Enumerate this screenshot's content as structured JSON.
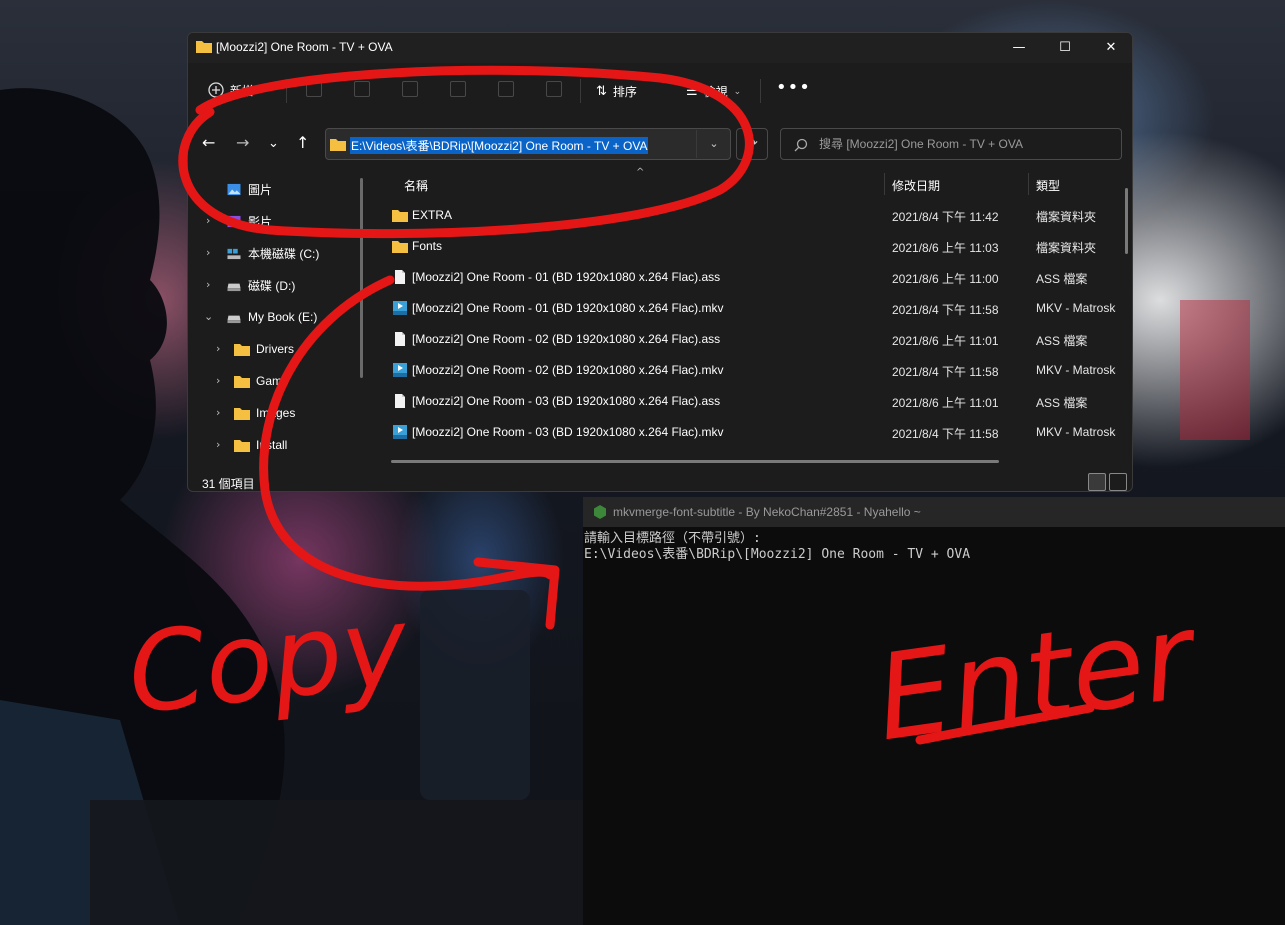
{
  "explorer": {
    "title": "[Moozzi2] One Room - TV + OVA",
    "window_buttons": {
      "minimize": "—",
      "maximize": "☐",
      "close": "✕"
    },
    "toolbar": {
      "new_label": "新增",
      "sort_label": "排序",
      "view_label": "檢視",
      "more_label": "•••"
    },
    "address": "E:\\Videos\\表番\\BDRip\\[Moozzi2] One Room - TV + OVA",
    "search_placeholder": "搜尋 [Moozzi2] One Room - TV + OVA",
    "sidebar": {
      "items": [
        {
          "label": "圖片",
          "icon": "pictures-icon"
        },
        {
          "label": "影片",
          "icon": "videos-icon"
        },
        {
          "label": "本機磁碟 (C:)",
          "icon": "drive-icon"
        },
        {
          "label": "磁碟 (D:)",
          "icon": "drive-icon"
        },
        {
          "label": "My Book (E:)",
          "icon": "drive-icon"
        },
        {
          "label": "Drivers",
          "icon": "folder-icon"
        },
        {
          "label": "Game",
          "icon": "folder-icon"
        },
        {
          "label": "Images",
          "icon": "folder-icon"
        },
        {
          "label": "Install",
          "icon": "folder-icon"
        }
      ]
    },
    "columns": {
      "name": "名稱",
      "date": "修改日期",
      "type": "類型"
    },
    "files": [
      {
        "name": "EXTRA",
        "date": "2021/8/4 下午 11:42",
        "type": "檔案資料夾",
        "icon": "folder-icon"
      },
      {
        "name": "Fonts",
        "date": "2021/8/6 上午 11:03",
        "type": "檔案資料夾",
        "icon": "folder-icon"
      },
      {
        "name": "[Moozzi2] One Room - 01 (BD 1920x1080 x.264 Flac).ass",
        "date": "2021/8/6 上午 11:00",
        "type": "ASS 檔案",
        "icon": "document-icon"
      },
      {
        "name": "[Moozzi2] One Room - 01 (BD 1920x1080 x.264 Flac).mkv",
        "date": "2021/8/4 下午 11:58",
        "type": "MKV - Matroska",
        "icon": "mkv-icon"
      },
      {
        "name": "[Moozzi2] One Room - 02 (BD 1920x1080 x.264 Flac).ass",
        "date": "2021/8/6 上午 11:01",
        "type": "ASS 檔案",
        "icon": "document-icon"
      },
      {
        "name": "[Moozzi2] One Room - 02 (BD 1920x1080 x.264 Flac).mkv",
        "date": "2021/8/4 下午 11:58",
        "type": "MKV - Matroska",
        "icon": "mkv-icon"
      },
      {
        "name": "[Moozzi2] One Room - 03 (BD 1920x1080 x.264 Flac).ass",
        "date": "2021/8/6 上午 11:01",
        "type": "ASS 檔案",
        "icon": "document-icon"
      },
      {
        "name": "[Moozzi2] One Room - 03 (BD 1920x1080 x.264 Flac).mkv",
        "date": "2021/8/4 下午 11:58",
        "type": "MKV - Matroska",
        "icon": "mkv-icon"
      }
    ],
    "status": "31 個項目"
  },
  "console": {
    "title": "mkvmerge-font-subtitle - By NekoChan#2851 - Nyahello ~",
    "lines": [
      "請輸入目標路徑（不帶引號）:",
      "E:\\Videos\\表番\\BDRip\\[Moozzi2] One Room - TV + OVA"
    ]
  },
  "annotations": {
    "copy_text": "Copy",
    "enter_text": "Enter",
    "color": "#e51616"
  },
  "colors": {
    "selection": "#0a64c8",
    "folder": "#f5c042",
    "mkv": "#3aa0d8"
  }
}
